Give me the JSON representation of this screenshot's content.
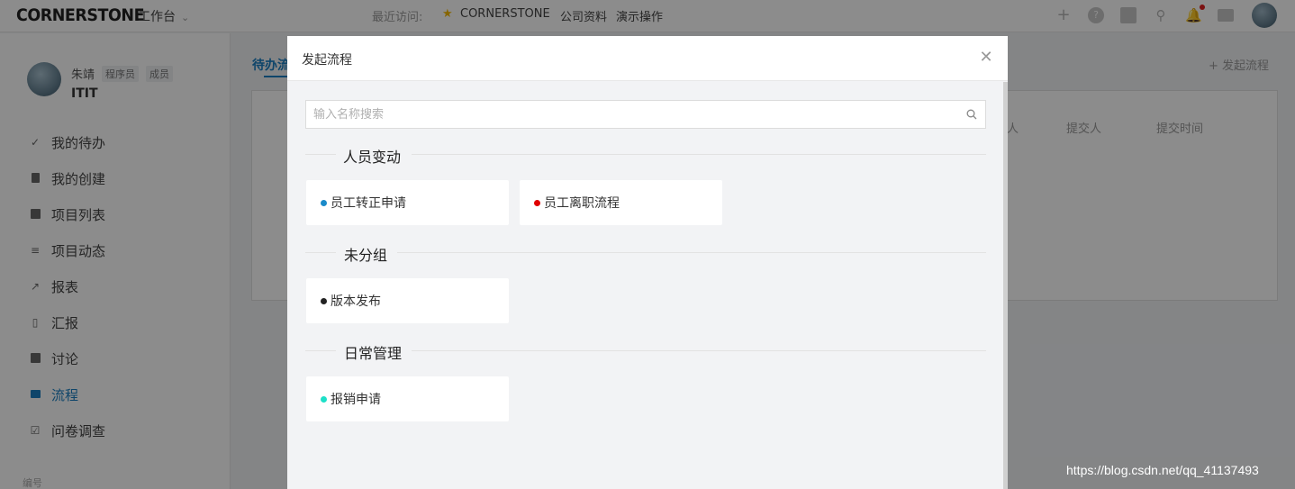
{
  "topbar": {
    "logo": "CORNERSTONE",
    "workbench": "工作台",
    "recent_label": "最近访问:",
    "recent_items": [
      "CORNERSTONE",
      "公司资料",
      "演示操作"
    ],
    "icons": [
      "plus-icon",
      "help-icon",
      "book-icon",
      "search-icon",
      "bell-icon",
      "box-icon"
    ]
  },
  "sidebar": {
    "user": {
      "name": "朱靖",
      "tags": [
        "程序员",
        "成员"
      ],
      "team": "ITIT"
    },
    "items": [
      {
        "label": "我的待办",
        "icon": "check-icon"
      },
      {
        "label": "我的创建",
        "icon": "doc-icon"
      },
      {
        "label": "项目列表",
        "icon": "list-icon"
      },
      {
        "label": "项目动态",
        "icon": "lines-icon"
      },
      {
        "label": "报表",
        "icon": "chart-icon"
      },
      {
        "label": "汇报",
        "icon": "clipboard-icon"
      },
      {
        "label": "讨论",
        "icon": "chat-icon"
      },
      {
        "label": "流程",
        "icon": "mail-icon",
        "active": true
      },
      {
        "label": "问卷调查",
        "icon": "checkbox-icon"
      }
    ],
    "footer": "编号"
  },
  "main": {
    "tab": "待办流",
    "start_button": "发起流程",
    "columns": [
      "人",
      "提交人",
      "提交时间"
    ]
  },
  "modal": {
    "title": "发起流程",
    "search_placeholder": "输入名称搜索",
    "groups": [
      {
        "title": "人员变动",
        "items": [
          {
            "label": "员工转正申请",
            "color": "#1a8ac9"
          },
          {
            "label": "员工离职流程",
            "color": "#e00000"
          }
        ]
      },
      {
        "title": "未分组",
        "items": [
          {
            "label": "版本发布",
            "color": "#222222"
          }
        ]
      },
      {
        "title": "日常管理",
        "items": [
          {
            "label": "报销申请",
            "color": "#1de0c8"
          }
        ]
      }
    ]
  },
  "watermark": "https://blog.csdn.net/qq_41137493"
}
